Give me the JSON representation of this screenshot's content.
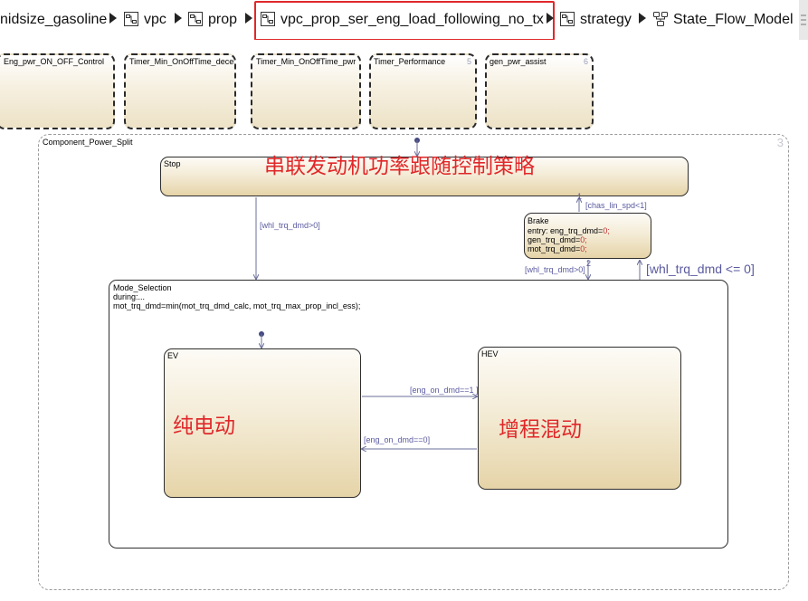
{
  "breadcrumb": {
    "items": [
      {
        "label": "nidsize_gasoline",
        "icon": "none"
      },
      {
        "label": "vpc",
        "icon": "subsystem-icon"
      },
      {
        "label": "prop",
        "icon": "subsystem-icon"
      },
      {
        "label": "vpc_prop_ser_eng_load_following_no_tx",
        "icon": "subsystem-icon",
        "highlighted": true
      },
      {
        "label": "strategy",
        "icon": "subsystem-icon"
      },
      {
        "label": "State_Flow_Model",
        "icon": "chart-icon"
      }
    ],
    "highlight_color": "#e0282a"
  },
  "parallel_states": [
    {
      "label": "Eng_pwr_ON_OFF_Control"
    },
    {
      "label": "Timer_Min_OnOffTime_decel"
    },
    {
      "label": "Timer_Min_OnOffTime_pwr"
    },
    {
      "label": "Timer_Performance",
      "order": "5"
    },
    {
      "label": "gen_pwr_assist",
      "order": "6"
    }
  ],
  "component": {
    "label": "Component_Power_Split",
    "order": "3"
  },
  "stop_state": {
    "label": "Stop"
  },
  "brake_state": {
    "label": "Brake",
    "lines": [
      "entry: eng_trq_dmd=",
      "gen_trq_dmd=",
      "mot_trq_dmd="
    ],
    "values": [
      "0;",
      "0;",
      "0;"
    ]
  },
  "mode_selection": {
    "label": "Mode_Selection",
    "line1": "during:...",
    "line2": "mot_trq_dmd=min(mot_trq_dmd_calc, mot_trq_max_prop_incl_ess);"
  },
  "ev_state": {
    "label": "EV"
  },
  "hev_state": {
    "label": "HEV"
  },
  "transitions": {
    "stop_to_mode": "[whl_trq_dmd>0]",
    "brake_to_stop": "[chas_lin_spd<1]",
    "brake_to_stop_order": "1",
    "brake_to_mode": "[whl_trq_dmd>0]",
    "brake_to_mode_order": "2",
    "mode_to_brake": "[whl_trq_dmd <= 0]",
    "ev_to_hev": "[eng_on_dmd==1 ]",
    "hev_to_ev": "[eng_on_dmd==0]"
  },
  "annotations": {
    "title": "串联发动机功率跟随控制策略",
    "ev": "纯电动",
    "hev": "增程混动"
  },
  "colors": {
    "annotation": "#e0282a",
    "transition_label": "#5a5aa0",
    "transition_line": "#6b6f9a",
    "state_border": "#2e2e2e"
  }
}
